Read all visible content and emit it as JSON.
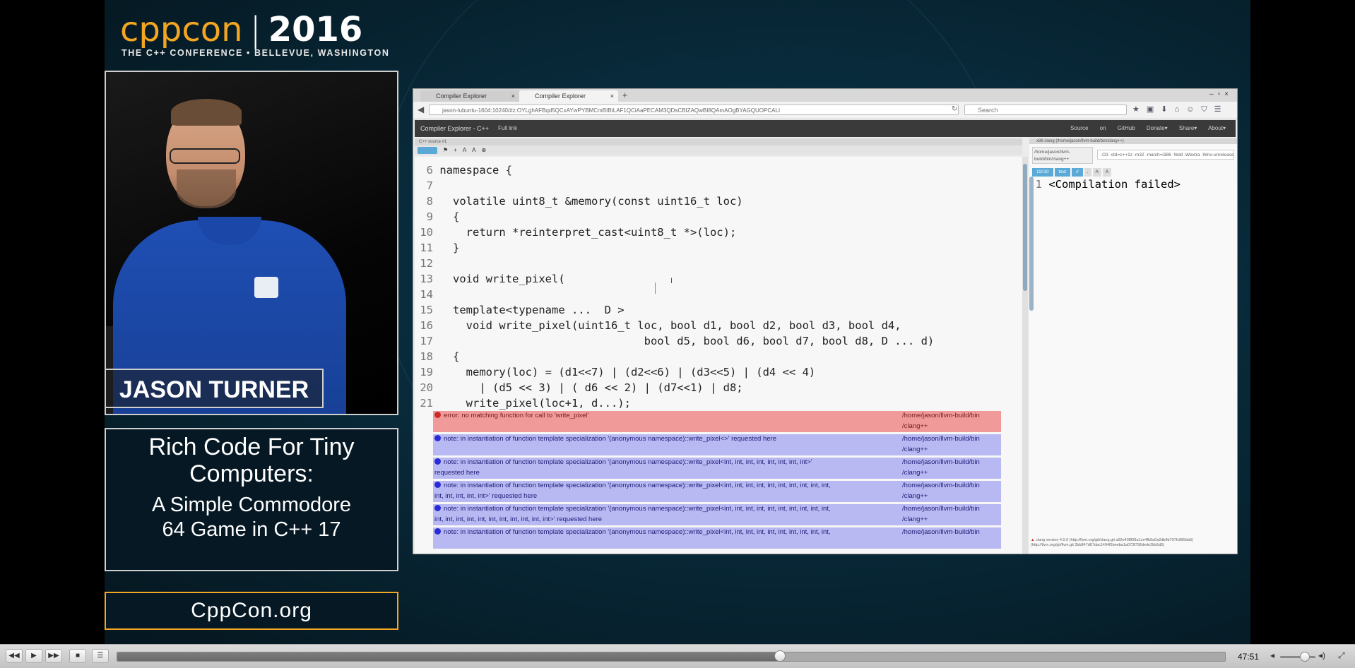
{
  "slide": {
    "logo_left": "cppcon",
    "logo_bar": "|",
    "logo_year": "2016",
    "tagline": "THE C++ CONFERENCE • BELLEVUE, WASHINGTON",
    "speaker_name": "JASON TURNER",
    "talk_title": "Rich Code For Tiny Computers:",
    "talk_subtitle": "A Simple Commodore 64 Game in C++ 17",
    "website": "CppCon.org"
  },
  "browser": {
    "tabs": [
      {
        "label": "Compiler Explorer",
        "close": "×"
      },
      {
        "label": "Compiler Explorer",
        "close": "×"
      }
    ],
    "new_tab": "+",
    "url": "jason-lubuntu-1604:10240/#z:OYLghAFBqd5QCxAYwPYBMCmBIBtLAF1QCiAaPECAM3QDsCBIZAQwBI8QAmAOgBYAGQUOPCALI",
    "search_placeholder": "Search",
    "window_controls": "–▫×"
  },
  "compiler_explorer": {
    "brand": "Compiler Explorer - C++",
    "full_link": "Full link",
    "nav_right": [
      "Source on GitHub",
      "Donate▾",
      "Share▾",
      "About▾"
    ],
    "editor_header": "C++ source #1",
    "code_lines": [
      {
        "num": "6",
        "text": "namespace {"
      },
      {
        "num": "7",
        "text": ""
      },
      {
        "num": "8",
        "text": "  volatile uint8_t &memory(const uint16_t loc)"
      },
      {
        "num": "9",
        "text": "  {"
      },
      {
        "num": "10",
        "text": "    return *reinterpret_cast<uint8_t *>(loc);"
      },
      {
        "num": "11",
        "text": "  }"
      },
      {
        "num": "12",
        "text": ""
      },
      {
        "num": "13",
        "text": "  void write_pixel("
      },
      {
        "num": "14",
        "text": ""
      },
      {
        "num": "15",
        "text": "  template<typename ...  D >"
      },
      {
        "num": "16",
        "text": "    void write_pixel(uint16_t loc, bool d1, bool d2, bool d3, bool d4,"
      },
      {
        "num": "17",
        "text": "                               bool d5, bool d6, bool d7, bool d8, D ... d)"
      },
      {
        "num": "18",
        "text": "  {"
      },
      {
        "num": "19",
        "text": "    memory(loc) = (d1<<7) | (d2<<6) | (d3<<5) | (d4 << 4)"
      },
      {
        "num": "20",
        "text": "      | (d5 << 3) | ( d6 << 2) | (d7<<1) | d8;"
      },
      {
        "num": "21",
        "text": "    write_pixel(loc+1, d...);"
      }
    ],
    "diagnostics": [
      {
        "kind": "error",
        "text": "error: no matching function for call to 'write_pixel'",
        "path": "/home/jason/llvm-build/bin",
        "path2": "/clang++"
      },
      {
        "kind": "note",
        "text": "note: in instantiation of function template specialization '(anonymous namespace)::write_pixel<>' requested here",
        "path": "/home/jason/llvm-build/bin",
        "path2": "/clang++"
      },
      {
        "kind": "note",
        "text": "note: in instantiation of function template specialization '(anonymous namespace)::write_pixel<int, int, int, int, int, int, int, int>'",
        "text2": "requested here",
        "path": "/home/jason/llvm-build/bin",
        "path2": "/clang++"
      },
      {
        "kind": "note",
        "text": "note: in instantiation of function template specialization '(anonymous namespace)::write_pixel<int, int, int, int, int, int, int, int, int, int,",
        "text2": "int, int, int, int, int>' requested here",
        "path": "/home/jason/llvm-build/bin",
        "path2": "/clang++"
      },
      {
        "kind": "note",
        "text": "note: in instantiation of function template specialization '(anonymous namespace)::write_pixel<int, int, int, int, int, int, int, int, int, int,",
        "text2": "int, int, int, int, int, int, int, int, int, int, int>' requested here",
        "path": "/home/jason/llvm-build/bin",
        "path2": "/clang++"
      },
      {
        "kind": "note",
        "text": "note: in instantiation of function template specialization '(anonymous namespace)::write_pixel<int, int, int, int, int, int, int, int, int, int,",
        "text2": "",
        "path": "/home/jason/llvm-build/bin",
        "path2": ""
      }
    ],
    "output_header": "x86 clang (/home/jason/llvm-build/bin/clang++)",
    "output_compiler": "/home/jason/llvm-build/bin/clang++",
    "output_flags": "-O3 -std=c++1z -m32 -march=i386 -Wall -Wextra -Wno-unreleased",
    "output_tools": [
      "11010",
      "text",
      "//",
      ".",
      "A",
      "A"
    ],
    "output_line_num": "1",
    "output_text": "<Compilation failed>",
    "output_status": "clang version 4.0.0 (http://llvm.org/git/clang.git a52e408f09a1ce4fb9a0a2db9b707fc885bb5)",
    "output_status2": "(http://llvm.org/git/llvm.git 2bb847d67dac1404f5beeba1a073f798dede2bb5d5)"
  },
  "player": {
    "buttons": [
      "rewind",
      "play",
      "fast-forward",
      "stop",
      "playlist"
    ],
    "progress_fraction": 0.598,
    "time": "47:51",
    "volume_fraction": 0.7
  }
}
